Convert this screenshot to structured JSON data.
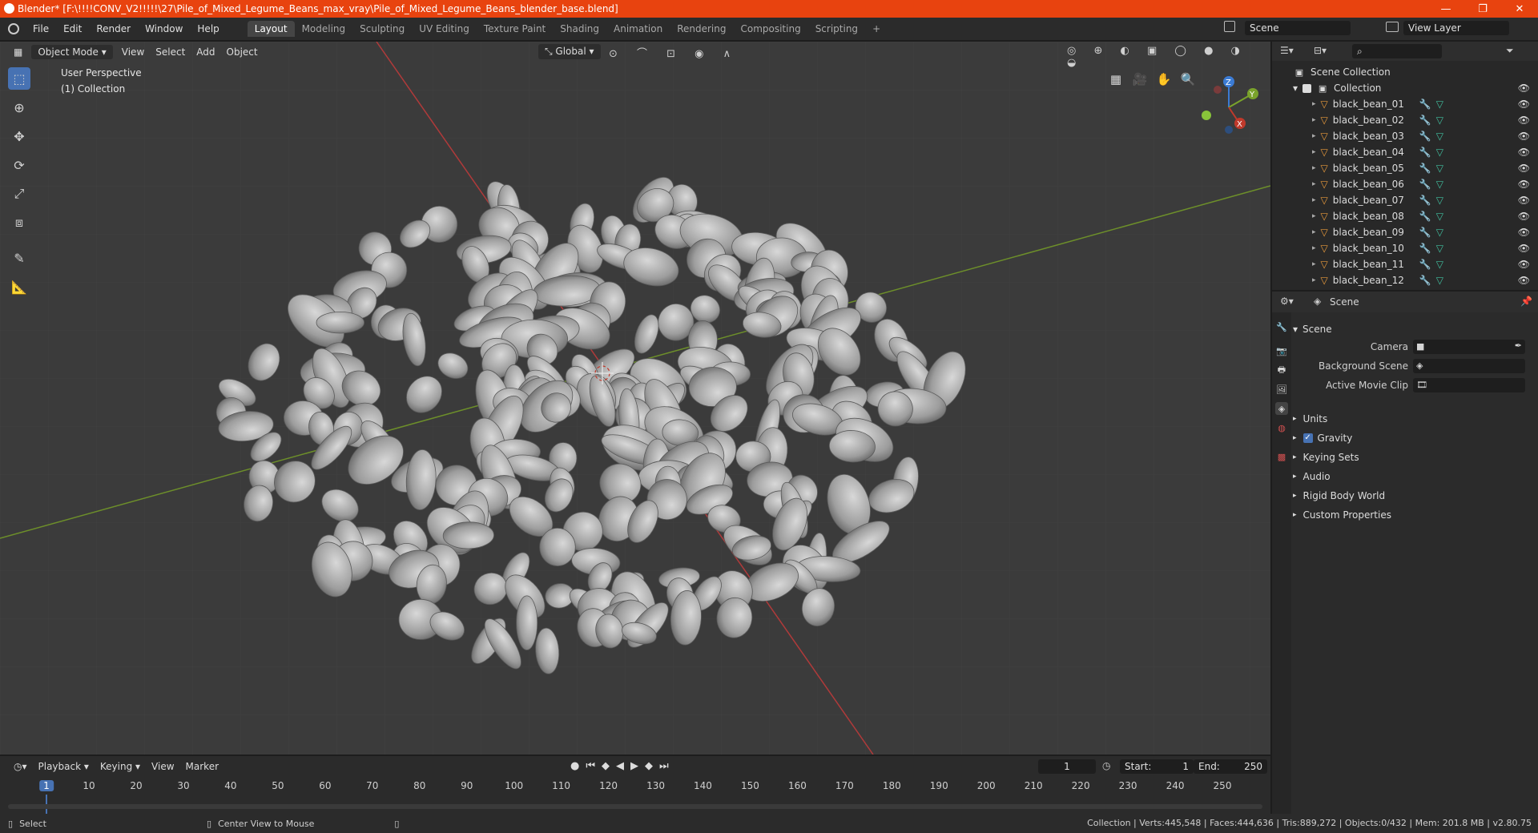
{
  "window": {
    "title": "Blender* [F:\\!!!!CONV_V2!!!!!\\27\\Pile_of_Mixed_Legume_Beans_max_vray\\Pile_of_Mixed_Legume_Beans_blender_base.blend]",
    "minimize": "—",
    "maximize": "❐",
    "close": "✕"
  },
  "menu": [
    "File",
    "Edit",
    "Render",
    "Window",
    "Help"
  ],
  "workspaces": [
    "Layout",
    "Modeling",
    "Sculpting",
    "UV Editing",
    "Texture Paint",
    "Shading",
    "Animation",
    "Rendering",
    "Compositing",
    "Scripting"
  ],
  "workspace_add": "+",
  "scene_field": "Scene",
  "view_layer_field": "View Layer",
  "viewport": {
    "mode": "Object Mode",
    "menus": [
      "View",
      "Select",
      "Add",
      "Object"
    ],
    "transform_orientation": "Global",
    "overlay_line1": "User Perspective",
    "overlay_line2": "(1) Collection",
    "gizmo_x": "X",
    "gizmo_y": "Y",
    "gizmo_z": "Z"
  },
  "outliner": {
    "root": "Scene Collection",
    "collection": "Collection",
    "items": [
      "black_bean_01",
      "black_bean_02",
      "black_bean_03",
      "black_bean_04",
      "black_bean_05",
      "black_bean_06",
      "black_bean_07",
      "black_bean_08",
      "black_bean_09",
      "black_bean_10",
      "black_bean_11",
      "black_bean_12"
    ]
  },
  "properties": {
    "context": "Scene",
    "panel": "Scene",
    "camera_label": "Camera",
    "background_scene_label": "Background Scene",
    "active_movie_clip_label": "Active Movie Clip",
    "subpanels": [
      "Units",
      "Gravity",
      "Keying Sets",
      "Audio",
      "Rigid Body World",
      "Custom Properties"
    ]
  },
  "timeline": {
    "menus": [
      "Playback",
      "Keying",
      "View",
      "Marker"
    ],
    "current_frame": "1",
    "start_label": "Start:",
    "start": "1",
    "end_label": "End:",
    "end": "250",
    "ticks": [
      "1",
      "10",
      "20",
      "30",
      "40",
      "50",
      "60",
      "70",
      "80",
      "90",
      "100",
      "110",
      "120",
      "130",
      "140",
      "150",
      "160",
      "170",
      "180",
      "190",
      "200",
      "210",
      "220",
      "230",
      "240",
      "250"
    ]
  },
  "status": {
    "left": "Select",
    "middle": "Center View to Mouse",
    "right": "Collection | Verts:445,548 | Faces:444,636 | Tris:889,272 | Objects:0/432 | Mem: 201.8 MB | v2.80.75"
  },
  "colors": {
    "titlebar": "#e8430f",
    "accent": "#4772b3",
    "viewport_bg": "#3b3b3b",
    "axis_x": "#c0392b",
    "axis_y": "#7aa32b"
  }
}
